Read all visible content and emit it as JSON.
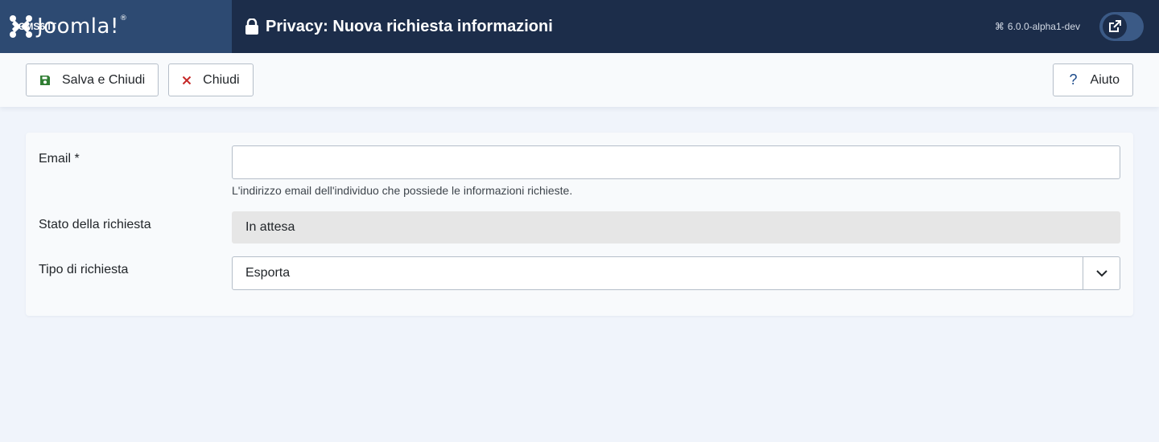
{
  "header": {
    "logo_text": "Joomla!",
    "logo_icon": "joomla-logo-icon",
    "title": "Privacy: Nuova richiesta informazioni",
    "title_icon": "lock-icon",
    "version": "6.0.0-alpha1-dev",
    "version_icon": "joomla-small-icon",
    "site_button_label": "JCMS6 IT",
    "site_button_icon": "external-link-icon"
  },
  "toolbar": {
    "save_close_label": "Salva e Chiudi",
    "save_close_icon": "save-icon",
    "close_label": "Chiudi",
    "close_icon": "close-icon",
    "help_label": "Aiuto",
    "help_icon": "question-icon"
  },
  "form": {
    "email": {
      "label": "Email *",
      "value": "",
      "hint": "L'indirizzo email dell'individuo che possiede le informazioni richieste."
    },
    "status": {
      "label": "Stato della richiesta",
      "value": "In attesa"
    },
    "request_type": {
      "label": "Tipo di richiesta",
      "value": "Esporta",
      "arrow_icon": "chevron-down-icon"
    }
  },
  "colors": {
    "header_bg": "#1c2d4a",
    "logo_bg": "#2d4a72",
    "save_icon": "#2f7d32",
    "close_icon": "#c52827",
    "help_icon": "#1c4a8a",
    "page_bg": "#f0f4fb"
  }
}
